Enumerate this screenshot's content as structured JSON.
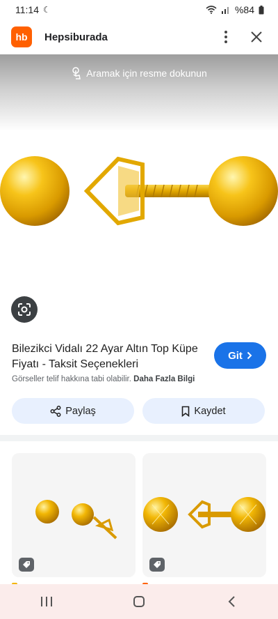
{
  "status_bar": {
    "time": "11:14",
    "battery": "%84"
  },
  "app_bar": {
    "logo_text": "hb",
    "title": "Hepsiburada"
  },
  "image_view": {
    "search_hint": "Aramak için resme dokunun"
  },
  "result": {
    "title": "Bilezikci Vidalı 22 Ayar Altın Top Küpe Fiyatı - Taksit Seçenekleri",
    "go_label": "Git",
    "copyright_text": "Görseller telif hakkına tabi olabilir.",
    "more_info_label": "Daha Fazla Bilgi"
  },
  "actions": {
    "share_label": "Paylaş",
    "save_label": "Kaydet"
  },
  "colors": {
    "brand": "#ff6000",
    "primary": "#1a73e8",
    "gold": "#f2b705"
  }
}
